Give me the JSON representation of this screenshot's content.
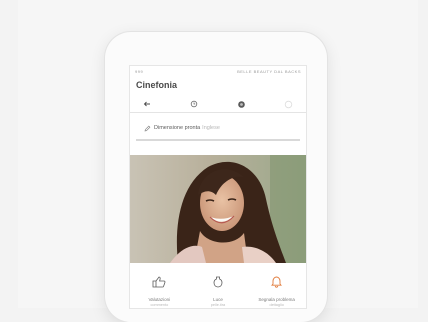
{
  "statusbar": {
    "left": "999",
    "right": "BELLE BEAUTY DAL BACKS"
  },
  "app": {
    "title": "Cinefonia"
  },
  "toolbar": {
    "icons": [
      "back-arrow-icon",
      "clock-icon",
      "camera-icon",
      "circle-icon"
    ]
  },
  "composer": {
    "label": "Dimensione pronta",
    "hint": "Inglese"
  },
  "actions": [
    {
      "icon": "thumbs-up-icon",
      "label": "Valutazioni",
      "sub": "commento"
    },
    {
      "icon": "bottle-icon",
      "label": "Luce",
      "sub": "pelle.tira"
    },
    {
      "icon": "bell-icon",
      "label": "Segnala problema",
      "sub": "dettaglio"
    }
  ],
  "colors": {
    "accent": "#e07a3a",
    "background": "#f3f3f3",
    "screen": "#ffffff"
  }
}
